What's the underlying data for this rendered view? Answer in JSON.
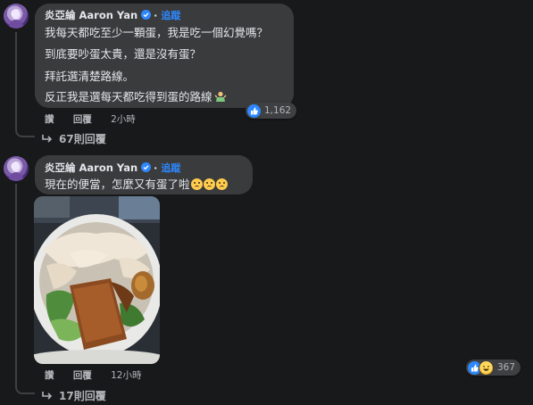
{
  "comments": [
    {
      "author": "炎亞綸 Aaron Yan",
      "follow_label": "追蹤",
      "separator": "·",
      "lines": [
        "我每天都吃至少一顆蛋，我是吃一個幻覺嗎？",
        "到底要吵蛋太貴，還是沒有蛋？",
        "拜託選清楚路線。",
        "反正我是選每天都吃得到蛋的路線"
      ],
      "actions": {
        "like": "讚",
        "reply": "回覆",
        "time": "2小時"
      },
      "reaction_count": "1,162",
      "replies_label": "67則回覆"
    },
    {
      "author": "炎亞綸 Aaron Yan",
      "follow_label": "追蹤",
      "separator": "·",
      "lines": [
        "現在的便當，怎麼又有蛋了啦"
      ],
      "actions": {
        "like": "讚",
        "reply": "回覆",
        "time": "12小時"
      },
      "reaction_count": "367",
      "replies_label": "17則回覆"
    }
  ],
  "icons": {
    "verified": "verified-badge-icon",
    "like": "thumbs-up-icon",
    "haha": "laughing-face-icon",
    "reply_arrow": "reply-arrow-icon"
  },
  "colors": {
    "background": "#18191a",
    "bubble": "#3a3b3c",
    "accent": "#2d88ff",
    "text": "#e4e6eb",
    "secondary_text": "#b0b3b8"
  }
}
